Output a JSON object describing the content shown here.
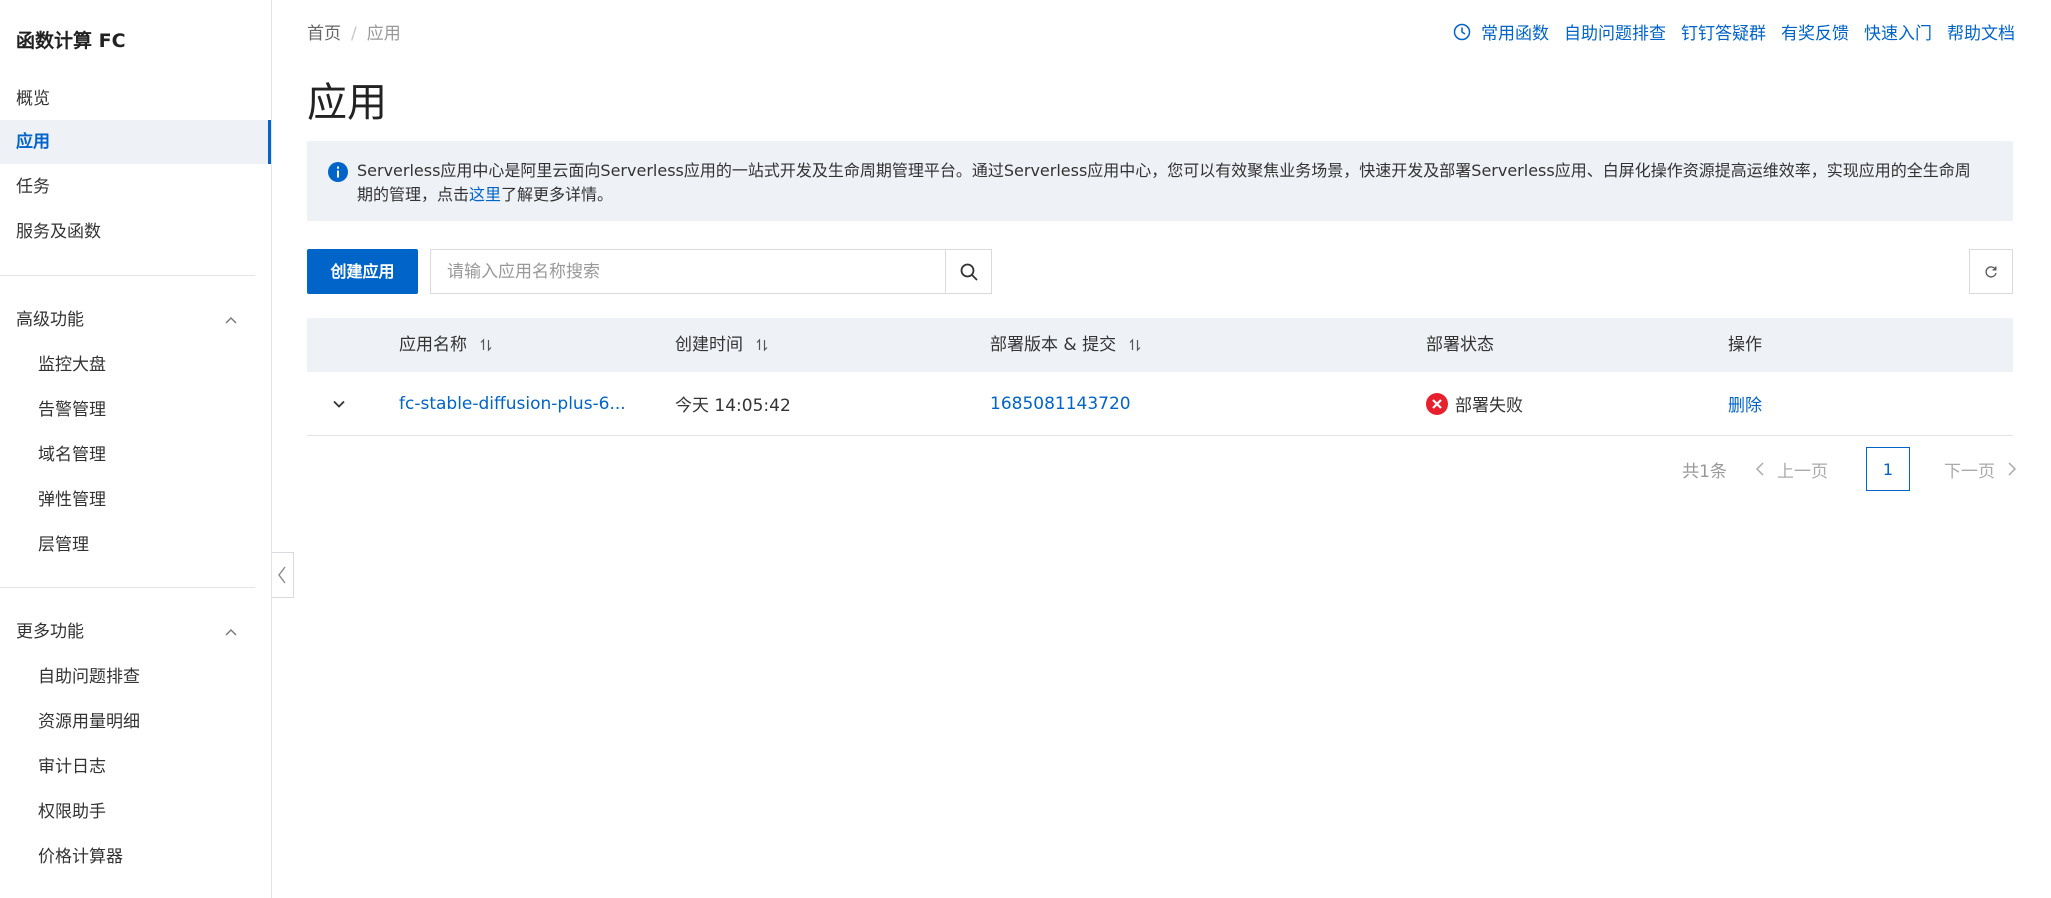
{
  "sidebar": {
    "title": "函数计算 FC",
    "items": [
      {
        "label": "概览"
      },
      {
        "label": "应用"
      },
      {
        "label": "任务"
      },
      {
        "label": "服务及函数"
      }
    ],
    "advanced": {
      "label": "高级功能",
      "items": [
        {
          "label": "监控大盘"
        },
        {
          "label": "告警管理"
        },
        {
          "label": "域名管理"
        },
        {
          "label": "弹性管理"
        },
        {
          "label": "层管理"
        }
      ]
    },
    "more": {
      "label": "更多功能",
      "items": [
        {
          "label": "自助问题排查"
        },
        {
          "label": "资源用量明细"
        },
        {
          "label": "审计日志"
        },
        {
          "label": "权限助手"
        },
        {
          "label": "价格计算器"
        }
      ]
    }
  },
  "breadcrumb": {
    "home": "首页",
    "sep": "/",
    "current": "应用"
  },
  "toplinks": [
    "常用函数",
    "自助问题排查",
    "钉钉答疑群",
    "有奖反馈",
    "快速入门",
    "帮助文档"
  ],
  "page": {
    "title": "应用"
  },
  "notice": {
    "text_before": "Serverless应用中心是阿里云面向Serverless应用的一站式开发及生命周期管理平台。通过Serverless应用中心，您可以有效聚焦业务场景，快速开发及部署Serverless应用、白屏化操作资源提高运维效率，实现应用的全生命周期的管理，点击",
    "link": "这里",
    "text_after": "了解更多详情。"
  },
  "toolbar": {
    "create_label": "创建应用",
    "search_placeholder": "请输入应用名称搜索"
  },
  "table": {
    "headers": {
      "name": "应用名称",
      "created": "创建时间",
      "version": "部署版本 & 提交",
      "status": "部署状态",
      "actions": "操作"
    },
    "rows": [
      {
        "name": "fc-stable-diffusion-plus-6...",
        "created": "今天 14:05:42",
        "version": "1685081143720",
        "status": "部署失败",
        "action": "删除"
      }
    ]
  },
  "pagination": {
    "total": "共1条",
    "prev": "上一页",
    "current": "1",
    "next": "下一页"
  },
  "colors": {
    "accent": "#0064c8",
    "error": "#e8202d",
    "header_bg": "#eef1f6"
  }
}
